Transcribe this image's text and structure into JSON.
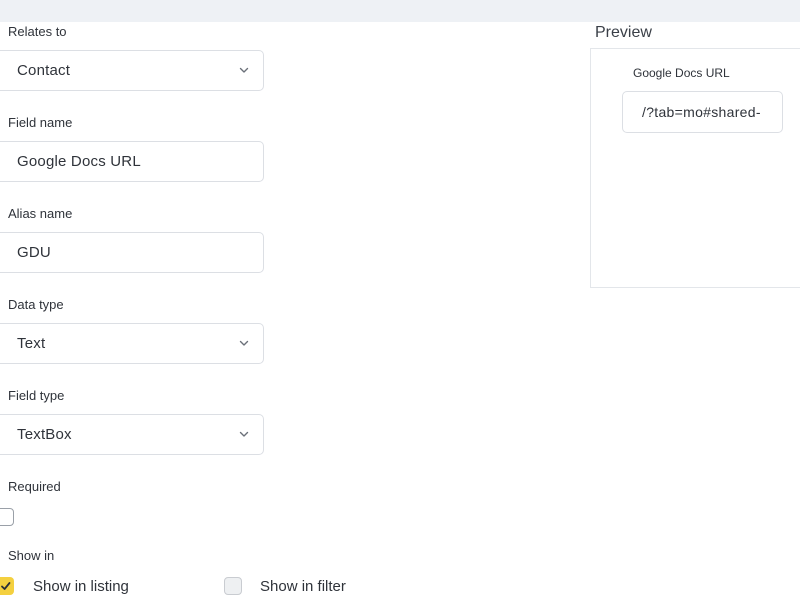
{
  "form": {
    "relates_to": {
      "label": "Relates to",
      "value": "Contact"
    },
    "field_name": {
      "label": "Field name",
      "value": "Google Docs URL"
    },
    "alias_name": {
      "label": "Alias name",
      "value": "GDU"
    },
    "data_type": {
      "label": "Data type",
      "value": "Text"
    },
    "field_type": {
      "label": "Field type",
      "value": "TextBox"
    },
    "required": {
      "label": "Required",
      "checked": false
    },
    "show_in": {
      "label": "Show in",
      "options": [
        {
          "label": "Show in listing",
          "checked": true
        },
        {
          "label": "Show in filter",
          "checked": false
        }
      ]
    }
  },
  "preview": {
    "title": "Preview",
    "field_label": "Google Docs URL",
    "field_value": "/?tab=mo#shared-"
  },
  "colors": {
    "accent_checkbox": "#f4d03f",
    "border": "#dcdfe4",
    "topbar": "#eef1f5"
  },
  "icons": {
    "dropdown": "chevron-down-icon",
    "check": "check-icon"
  }
}
